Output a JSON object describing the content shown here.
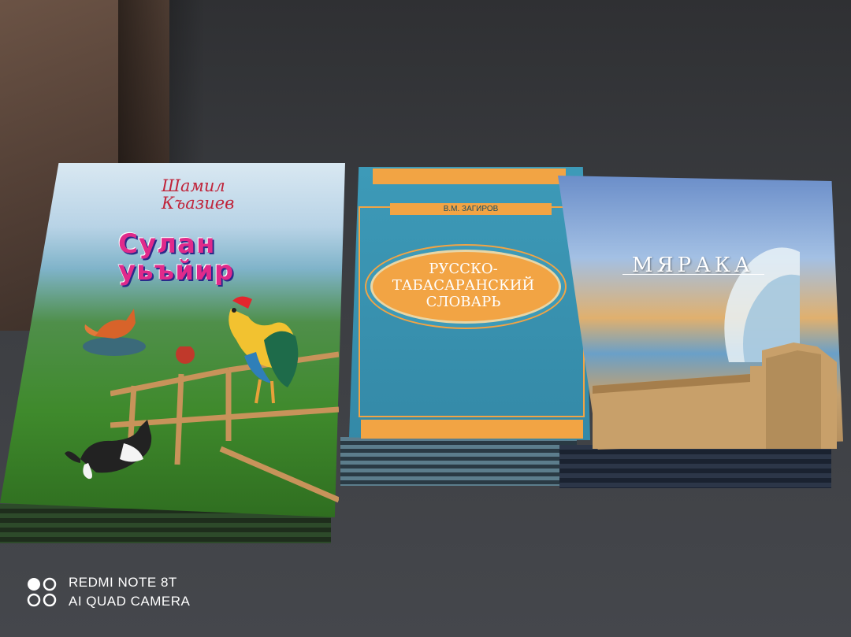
{
  "books": [
    {
      "author": "Шамил Къазиев",
      "title_line1": "Сулан",
      "title_line2": "уьъйир"
    },
    {
      "publisher_line": "В.М. ЗАГИРОВ",
      "title_line1": "РУССКО-",
      "title_line2": "ТАБАСАРАНСКИЙ",
      "title_line3": "СЛОВАРЬ"
    },
    {
      "title": "МЯРАКА"
    }
  ],
  "watermark": {
    "line1": "REDMI NOTE 8T",
    "line2": "AI QUAD CAMERA",
    "icon": "quad-camera-icon"
  },
  "colors": {
    "table": "#3a3c40",
    "book2_blue": "#3d9ab8",
    "book2_orange": "#f2a444",
    "book1_title": "#e02a8b",
    "book1_author": "#c0243a"
  }
}
